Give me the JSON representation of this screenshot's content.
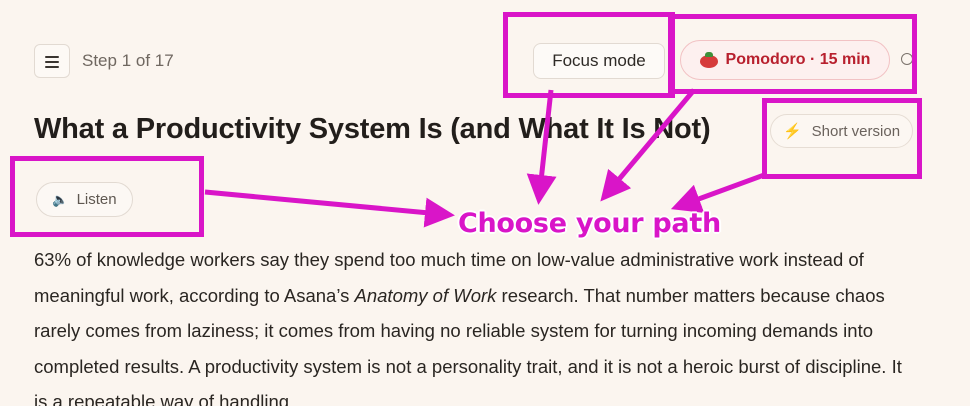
{
  "header": {
    "step_label": "Step 1 of 17",
    "focus_mode_label": "Focus mode",
    "pomodoro_label": "Pomodoro · 15 min"
  },
  "lesson": {
    "title": "What a Productivity System Is (and What It Is Not)",
    "short_version_label": "Short version",
    "listen_label": "Listen",
    "paragraph": {
      "part1": "63% of knowledge workers say they spend too much time on low-value administrative work instead of meaningful work, according to Asana’s ",
      "source": "Anatomy of Work",
      "part2": " research. That number matters because chaos rarely comes from laziness; it comes from having no reliable system for turning incoming demands into completed results. A productivity system is not a personality trait, and it is not a heroic burst of discipline. It is a repeatable way of handling"
    }
  },
  "annotation": {
    "label": "Choose your path",
    "color": "#d915c8"
  },
  "icons": {
    "menu": "hamburger-icon",
    "pomodoro": "tomato-icon",
    "timer": "timer-icon",
    "short_version": "lightning-icon",
    "listen": "speaker-icon"
  },
  "colors": {
    "background": "#fbf5ef",
    "pomodoro_text": "#b8202e",
    "pomodoro_bg": "#fdf0ef",
    "bolt": "#e8912c"
  }
}
